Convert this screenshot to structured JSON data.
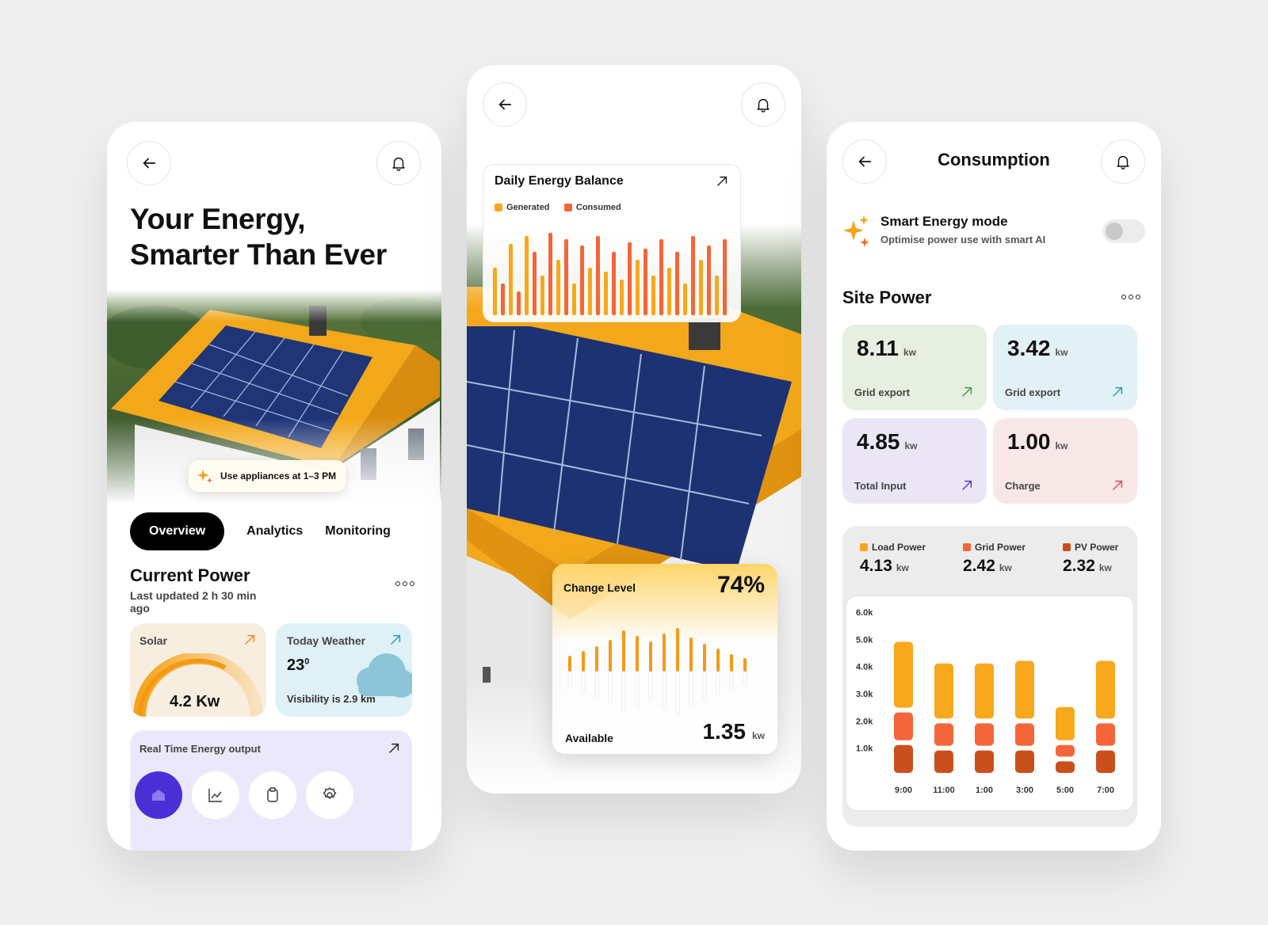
{
  "panel1": {
    "title_line1": "Your Energy,",
    "title_line2": "Smarter Than Ever",
    "hint": "Use appliances at 1–3 PM",
    "tabs": [
      "Overview",
      "Analytics",
      "Monitoring"
    ],
    "current_power": {
      "title": "Current Power",
      "subtitle_line1": "Last updated 2 h 30 min",
      "subtitle_line2": "ago"
    },
    "solar": {
      "label": "Solar",
      "value": "4.2 Kw",
      "gauge_fraction": 0.7
    },
    "weather": {
      "label": "Today Weather",
      "temp": "23",
      "deg": "0",
      "visibility": "Visibility is 2.9 km"
    },
    "realtime": {
      "label": "Real Time Energy output"
    },
    "nav_icons": [
      "home-icon",
      "chart-icon",
      "clipboard-icon",
      "gear-icon"
    ],
    "colors": {
      "accent": "#4a2fd6",
      "orange": "#f7a21b"
    }
  },
  "panel2": {
    "balance": {
      "title": "Daily Energy Balance",
      "legend": [
        "Generated",
        "Consumed"
      ]
    },
    "change": {
      "title": "Change Level",
      "percent": "74%",
      "available_label": "Available",
      "available_value": "1.35",
      "unit": "kw"
    }
  },
  "panel3": {
    "title": "Consumption",
    "smart": {
      "title": "Smart Energy mode",
      "subtitle": "Optimise power use with smart AI",
      "enabled": false
    },
    "site_power": {
      "title": "Site Power"
    },
    "metrics": [
      {
        "value": "8.11",
        "unit": "kw",
        "label": "Grid export",
        "bg": "#e6efe0",
        "accent": "#3f9e3a"
      },
      {
        "value": "3.42",
        "unit": "kw",
        "label": "Grid export",
        "bg": "#e2f1f5",
        "accent": "#1f9ec2"
      },
      {
        "value": "4.85",
        "unit": "kw",
        "label": "Total Input",
        "bg": "#ebe6f6",
        "accent": "#5a3ad0"
      },
      {
        "value": "1.00",
        "unit": "kw",
        "label": "Charge",
        "bg": "#f8e7e7",
        "accent": "#e04a4a"
      }
    ],
    "power_legend": [
      {
        "name": "Load Power",
        "value": "4.13",
        "unit": "kw",
        "color": "#f7a81b"
      },
      {
        "name": "Grid Power",
        "value": "2.42",
        "unit": "kw",
        "color": "#f4663a"
      },
      {
        "name": "PV Power",
        "value": "2.32",
        "unit": "kw",
        "color": "#c9501d"
      }
    ]
  },
  "chart_data": [
    {
      "type": "bar",
      "title": "Site Power",
      "categories": [
        "9:00",
        "11:00",
        "1:00",
        "3:00",
        "5:00",
        "7:00"
      ],
      "y_ticks": [
        "6.0k",
        "5.0k",
        "4.0k",
        "3.0k",
        "2.0k",
        "1.0k"
      ],
      "ylim": [
        0,
        6000
      ],
      "series": [
        {
          "name": "PV Power",
          "values": [
            1200,
            1000,
            1000,
            1000,
            600,
            1000
          ]
        },
        {
          "name": "Grid Power",
          "values": [
            1200,
            1000,
            1000,
            1000,
            600,
            1000
          ]
        },
        {
          "name": "Load Power",
          "values": [
            2600,
            2200,
            2200,
            2300,
            1400,
            2300
          ]
        }
      ],
      "legend_position": "top"
    }
  ]
}
